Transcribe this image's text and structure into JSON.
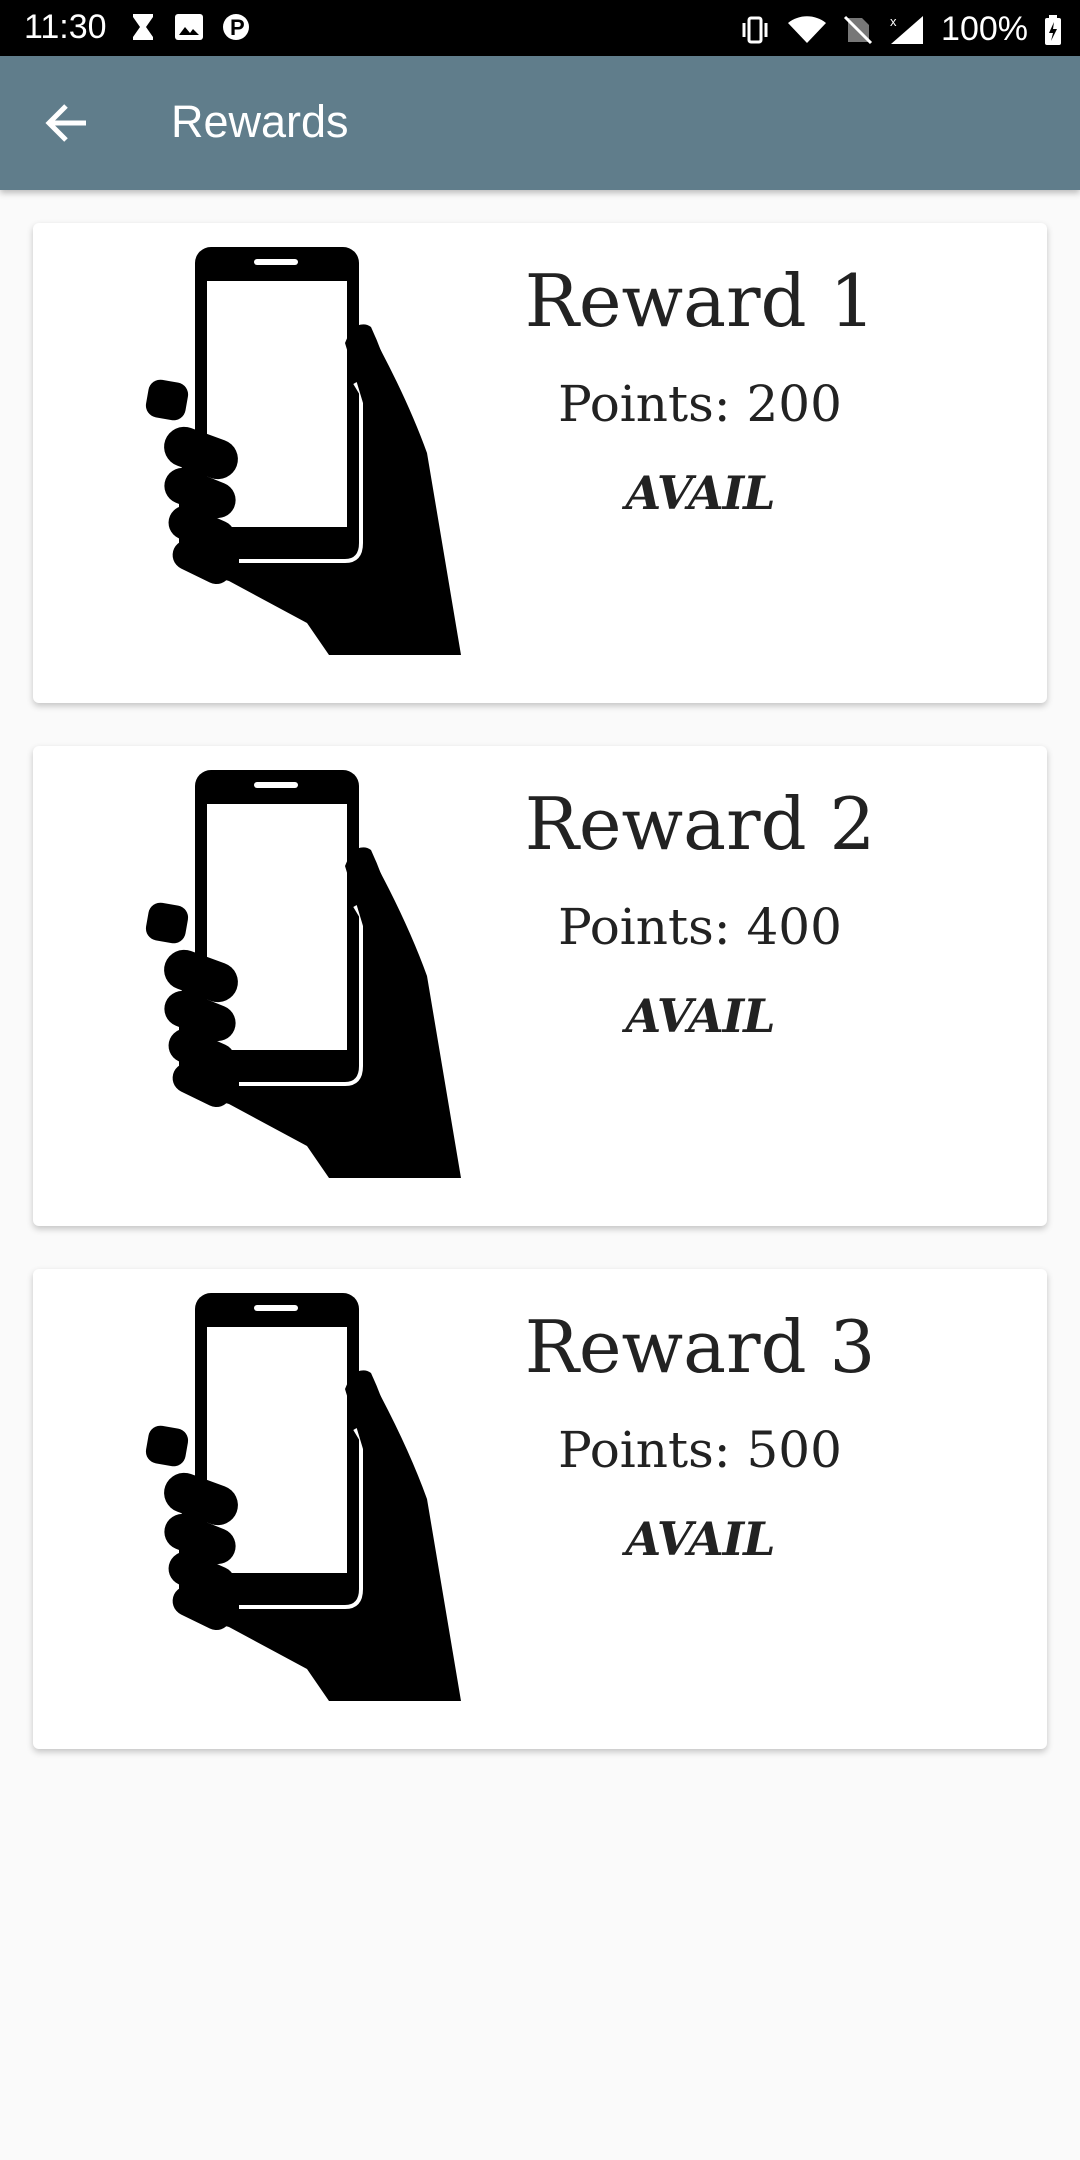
{
  "status_bar": {
    "time": "11:30",
    "battery": "100%"
  },
  "app_bar": {
    "title": "Rewards"
  },
  "rewards": [
    {
      "title": "Reward 1",
      "points": "Points: 200",
      "action": "AVAIL",
      "icon": "hand-holding-phone-icon"
    },
    {
      "title": "Reward 2",
      "points": "Points: 400",
      "action": "AVAIL",
      "icon": "hand-holding-phone-icon"
    },
    {
      "title": "Reward 3",
      "points": "Points: 500",
      "action": "AVAIL",
      "icon": "hand-holding-phone-icon"
    }
  ],
  "colors": {
    "app_bar": "#607d8b",
    "background": "#fafafa",
    "card": "#ffffff"
  }
}
